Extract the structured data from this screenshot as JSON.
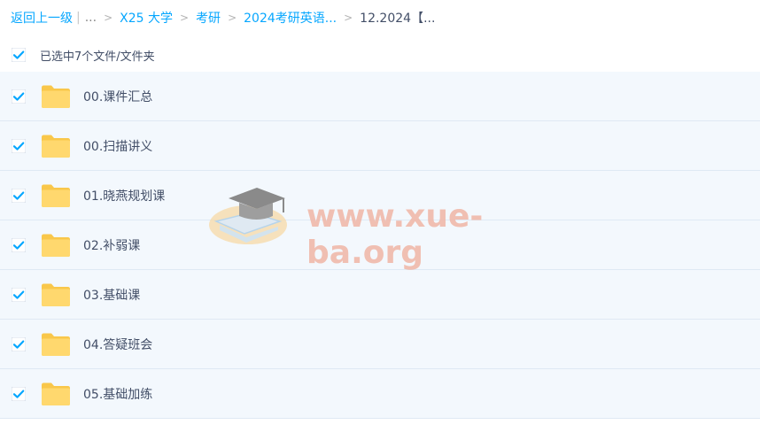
{
  "colors": {
    "accent": "#06a7ff",
    "row_bg": "#f3f8fd",
    "folder": "#ffd56b",
    "watermark": "#f0b6a6"
  },
  "breadcrumb": {
    "back_label": "返回上一级",
    "ellipsis": "...",
    "items": [
      "X25 大学",
      "考研",
      "2024考研英语..."
    ],
    "current": "12.2024【..."
  },
  "selection": {
    "label": "已选中7个文件/文件夹",
    "checked": true
  },
  "files": [
    {
      "name": "00.课件汇总",
      "checked": true,
      "icon": "folder-icon"
    },
    {
      "name": "00.扫描讲义",
      "checked": true,
      "icon": "folder-icon"
    },
    {
      "name": "01.晓燕规划课",
      "checked": true,
      "icon": "folder-icon"
    },
    {
      "name": "02.补弱课",
      "checked": true,
      "icon": "folder-icon"
    },
    {
      "name": "03.基础课",
      "checked": true,
      "icon": "folder-icon"
    },
    {
      "name": "04.答疑班会",
      "checked": true,
      "icon": "folder-icon"
    },
    {
      "name": "05.基础加练",
      "checked": true,
      "icon": "folder-icon"
    }
  ],
  "watermark": {
    "text": "www.xue-ba.org"
  }
}
